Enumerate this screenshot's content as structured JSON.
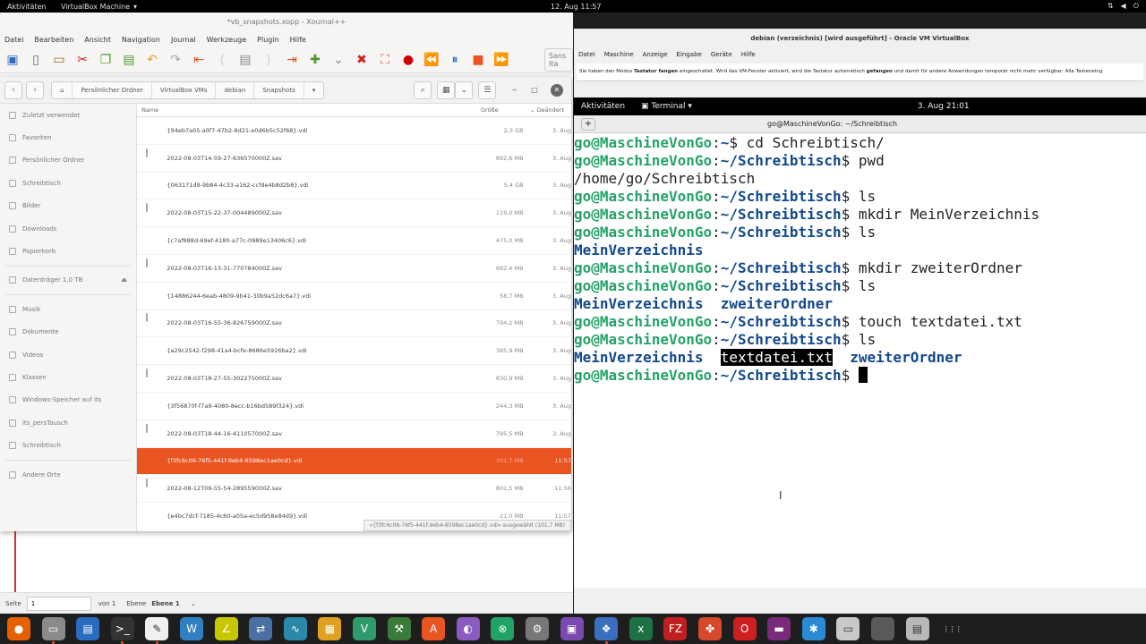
{
  "topbar": {
    "activities": "Aktivitäten",
    "app": "VirtualBox Machine",
    "clock": "12. Aug  11:57"
  },
  "xournal": {
    "title": "*vb_snapshots.xopp - Xournal++",
    "menu": [
      "Datei",
      "Bearbeiten",
      "Ansicht",
      "Navigation",
      "Journal",
      "Werkzeuge",
      "Plugin",
      "Hilfe"
    ],
    "font": "Sans Ita",
    "status": {
      "page_label": "Seite",
      "page_value": "1",
      "of": "von 1",
      "layer_label": "Ebene",
      "layer_value": "Ebene 1"
    }
  },
  "nautilus": {
    "breadcrumbs": [
      "Persönlicher Ordner",
      "VirtualBox VMs",
      "debian",
      "Snapshots"
    ],
    "sidebar": [
      {
        "label": "Zuletzt verwendet",
        "icon": "clock-icon"
      },
      {
        "label": "Favoriten",
        "icon": "star-icon"
      },
      {
        "label": "Persönlicher Ordner",
        "icon": "home-icon"
      },
      {
        "label": "Schreibtisch",
        "icon": "desktop-icon"
      },
      {
        "label": "Bilder",
        "icon": "pictures-icon"
      },
      {
        "label": "Downloads",
        "icon": "download-icon"
      },
      {
        "label": "Papierkorb",
        "icon": "trash-icon"
      },
      {
        "label": "Datenträger 1,0 TB",
        "icon": "drive-icon"
      },
      {
        "label": "Musik",
        "icon": "folder-icon"
      },
      {
        "label": "Dokumente",
        "icon": "folder-icon"
      },
      {
        "label": "Videos",
        "icon": "folder-icon"
      },
      {
        "label": "Klassen",
        "icon": "folder-icon"
      },
      {
        "label": "Windows-Speicher auf its",
        "icon": "network-folder-icon"
      },
      {
        "label": "its_persTausch",
        "icon": "network-folder-icon"
      },
      {
        "label": "Schreibtisch",
        "icon": "folder-icon"
      },
      {
        "label": "Andere Orte",
        "icon": "plus-icon"
      }
    ],
    "columns": {
      "name": "Name",
      "size": "Größe",
      "date": "Geändert"
    },
    "files": [
      {
        "name": "{94eb7a05-a0f7-47b2-8d21-e0d6b5c52f68}.vdi",
        "size": "2,3 GB",
        "date": "3. Aug",
        "type": "vdi"
      },
      {
        "name": "2022-08-03T14-59-27-636570000Z.sav",
        "size": "892,6 MB",
        "date": "3. Aug",
        "type": "sav"
      },
      {
        "name": "{063171d9-9b84-4c33-a162-ccfde4b8d2b8}.vdi",
        "size": "5,4 GB",
        "date": "3. Aug",
        "type": "vdi"
      },
      {
        "name": "2022-08-03T15-22-37-004489000Z.sav",
        "size": "119,0 MB",
        "date": "3. Aug",
        "type": "sav"
      },
      {
        "name": "{c7af988d-69ef-4180-a77c-0989e13406c6}.vdi",
        "size": "475,0 MB",
        "date": "3. Aug",
        "type": "vdi"
      },
      {
        "name": "2022-08-03T16-13-31-770784000Z.sav",
        "size": "692,4 MB",
        "date": "3. Aug",
        "type": "sav"
      },
      {
        "name": "{14886244-6eab-4809-9b41-30b9a52dc6a7}.vdi",
        "size": "58,7 MB",
        "date": "3. Aug",
        "type": "vdi"
      },
      {
        "name": "2022-08-03T16-55-36-826759000Z.sav",
        "size": "794,2 MB",
        "date": "3. Aug",
        "type": "sav"
      },
      {
        "name": "{a29c2542-f298-41a4-bcfe-8686e5926ba2}.vdi",
        "size": "385,9 MB",
        "date": "3. Aug",
        "type": "vdi"
      },
      {
        "name": "2022-08-03T18-27-55-302275000Z.sav",
        "size": "830,9 MB",
        "date": "3. Aug",
        "type": "sav"
      },
      {
        "name": "{3f56870f-f7a9-4080-8ecc-b16bd589f324}.vdi",
        "size": "244,3 MB",
        "date": "3. Aug",
        "type": "vdi"
      },
      {
        "name": "2022-08-03T18-44-16-411057000Z.sav",
        "size": "795,5 MB",
        "date": "3. Aug",
        "type": "sav"
      },
      {
        "name": "{f3fc6c06-76f5-441f-9eb4-8598ec1ae0cd}.vdi",
        "size": "101,7 MB",
        "date": "11:57",
        "type": "vdi",
        "selected": true
      },
      {
        "name": "2022-08-12T09-55-54-289559000Z.sav",
        "size": "801,5 MB",
        "date": "11:56",
        "type": "sav"
      },
      {
        "name": "{e4bc7dcf-7185-4c60-a05a-ec5d958e84d9}.vdi",
        "size": "21,0 MB",
        "date": "11:57",
        "type": "vdi"
      }
    ],
    "selection_info": "«{f3fc6c06-76f5-441f-9eb4-8598ec1ae0cd}.vdi» ausgewählt  (101,7 MB)"
  },
  "virtualbox": {
    "title": "debian (verzeichnis) [wird ausgeführt] - Oracle VM VirtualBox",
    "menu": [
      "Datei",
      "Maschine",
      "Anzeige",
      "Eingabe",
      "Geräte",
      "Hilfe"
    ],
    "info_pre": "Sie haben den Modus ",
    "info_b1": "Tastatur fangen",
    "info_mid": " eingeschaltet. Wird das VM-Fenster aktiviert, wird die Tastatur automatisch ",
    "info_b2": "gefangen",
    "info_post": " und damit für andere Anwendungen temporär nicht mehr verfügbar: Alle Tasteneing",
    "guest": {
      "activities": "Aktivitäten",
      "app": "Terminal ▾",
      "clock": "3. Aug  21:01",
      "terminal_title": "go@MaschineVonGo: ~/Schreibtisch"
    }
  },
  "terminal": {
    "user": "go@MaschineVonGo",
    "lines": [
      {
        "path": "~",
        "cmd": "cd Schreibtisch/"
      },
      {
        "path": "~/Schreibtisch",
        "cmd": "pwd"
      },
      {
        "output": "/home/go/Schreibtisch"
      },
      {
        "path": "~/Schreibtisch",
        "cmd": "ls"
      },
      {
        "path": "~/Schreibtisch",
        "cmd": "mkdir MeinVerzeichnis"
      },
      {
        "path": "~/Schreibtisch",
        "cmd": "ls"
      },
      {
        "dirs": [
          "MeinVerzeichnis"
        ]
      },
      {
        "path": "~/Schreibtisch",
        "cmd": "mkdir zweiterOrdner"
      },
      {
        "path": "~/Schreibtisch",
        "cmd": "ls"
      },
      {
        "dirs": [
          "MeinVerzeichnis",
          "zweiterOrdner"
        ]
      },
      {
        "path": "~/Schreibtisch",
        "cmd": "touch textdatei.txt"
      },
      {
        "path": "~/Schreibtisch",
        "cmd": "ls"
      },
      {
        "mixed": [
          {
            "t": "MeinVerzeichnis",
            "k": "dir"
          },
          {
            "t": "  ",
            "k": "sp"
          },
          {
            "t": "textdatei.txt",
            "k": "hl"
          },
          {
            "t": "  ",
            "k": "sp"
          },
          {
            "t": "zweiterOrdner",
            "k": "dir"
          }
        ]
      },
      {
        "path": "~/Schreibtisch",
        "cmd": "",
        "cursor": true
      }
    ]
  },
  "dock": [
    {
      "name": "firefox-icon",
      "color": "#e66000",
      "glyph": "●"
    },
    {
      "name": "files-icon",
      "color": "#8a8a8a",
      "glyph": "▭"
    },
    {
      "name": "writer-icon",
      "color": "#2a6cc0",
      "glyph": "▤"
    },
    {
      "name": "terminal-icon",
      "color": "#333333",
      "glyph": ">_"
    },
    {
      "name": "xournal-icon",
      "color": "#f0f0f0",
      "glyph": "✎"
    },
    {
      "name": "wave-icon",
      "color": "#2f7fc1",
      "glyph": "W"
    },
    {
      "name": "geogebra-icon",
      "color": "#c7c700",
      "glyph": "∠"
    },
    {
      "name": "network-icon",
      "color": "#4a6fa5",
      "glyph": "⇄"
    },
    {
      "name": "scope-icon",
      "color": "#2a88a8",
      "glyph": "∿"
    },
    {
      "name": "calculator-icon",
      "color": "#e0a020",
      "glyph": "▦"
    },
    {
      "name": "vector-icon",
      "color": "#2f9a6a",
      "glyph": "V"
    },
    {
      "name": "tool-icon",
      "color": "#3a7a3a",
      "glyph": "⚒"
    },
    {
      "name": "store-icon",
      "color": "#e95420",
      "glyph": "A"
    },
    {
      "name": "mixer-icon",
      "color": "#8a5cc0",
      "glyph": "◐"
    },
    {
      "name": "edge-icon",
      "color": "#21a366",
      "glyph": "⊗"
    },
    {
      "name": "settings-icon",
      "color": "#777777",
      "glyph": "⚙"
    },
    {
      "name": "gallery-icon",
      "color": "#7a4ab0",
      "glyph": "▣"
    },
    {
      "name": "virtualbox-icon",
      "color": "#3a6ebf",
      "glyph": "❖"
    },
    {
      "name": "excel-icon",
      "color": "#1e7045",
      "glyph": "x"
    },
    {
      "name": "filezilla-icon",
      "color": "#bf1f1f",
      "glyph": "FZ"
    },
    {
      "name": "puzzle-icon",
      "color": "#d44a2a",
      "glyph": "✤"
    },
    {
      "name": "opera-icon",
      "color": "#cc1f1f",
      "glyph": "O"
    },
    {
      "name": "screen-icon",
      "color": "#7a2a7a",
      "glyph": "▬"
    },
    {
      "name": "bluetooth-icon",
      "color": "#2a8ad4",
      "glyph": "✱"
    },
    {
      "name": "viewer-icon",
      "color": "#c8c8c8",
      "glyph": "▭"
    },
    {
      "name": "vb-machine-icon",
      "color": "#5a5a5a",
      "glyph": ""
    },
    {
      "name": "archive-icon",
      "color": "#b8b8b8",
      "glyph": "▤"
    },
    {
      "name": "apps-grid-icon",
      "color": "#1e1e1e",
      "glyph": "⋮⋮⋮"
    }
  ]
}
